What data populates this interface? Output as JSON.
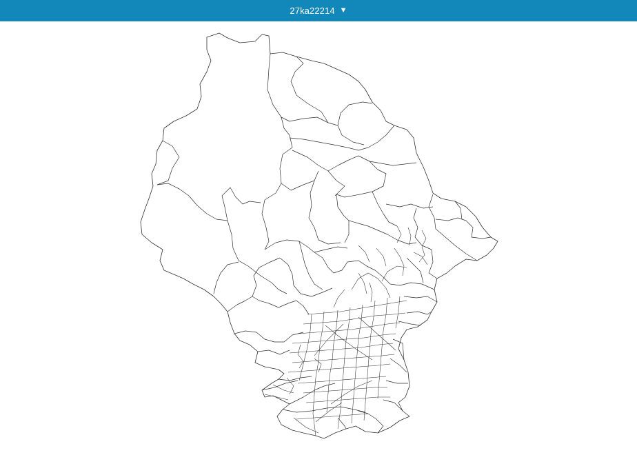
{
  "header": {
    "area_code": "27ka22214",
    "dropdown_icon": "triangle-down-icon"
  },
  "colors": {
    "header_bg": "#1187ba",
    "header_text": "#ffffff",
    "boundary_stroke": "#2f2f33",
    "map_fill": "#ffffff"
  }
}
